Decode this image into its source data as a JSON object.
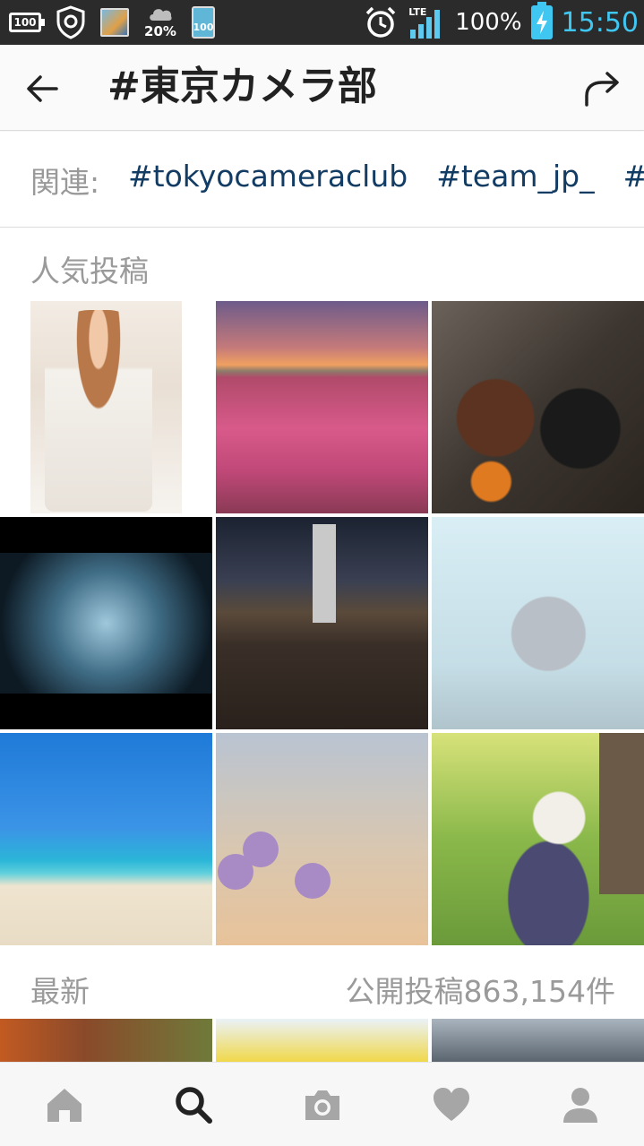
{
  "status_bar": {
    "battery_icon_text": "100",
    "weather_pct": "20%",
    "app_badge": "100",
    "network": "LTE",
    "battery_pct": "100%",
    "time": "15:50",
    "time_color": "#3fc7f2"
  },
  "header": {
    "title": "#東京カメラ部",
    "back_icon": "arrow-left-icon",
    "share_icon": "share-icon"
  },
  "related": {
    "label": "関連:",
    "tags": [
      "#tokyocameraclub",
      "#team_jp_",
      "#japan"
    ],
    "tag_color": "#123c63"
  },
  "popular": {
    "heading": "人気投稿"
  },
  "latest": {
    "heading": "最新",
    "count": "公開投稿863,154件"
  },
  "bottom_nav": {
    "items": [
      "home-icon",
      "search-icon",
      "camera-icon",
      "heart-icon",
      "profile-icon"
    ],
    "active": "search-icon"
  }
}
